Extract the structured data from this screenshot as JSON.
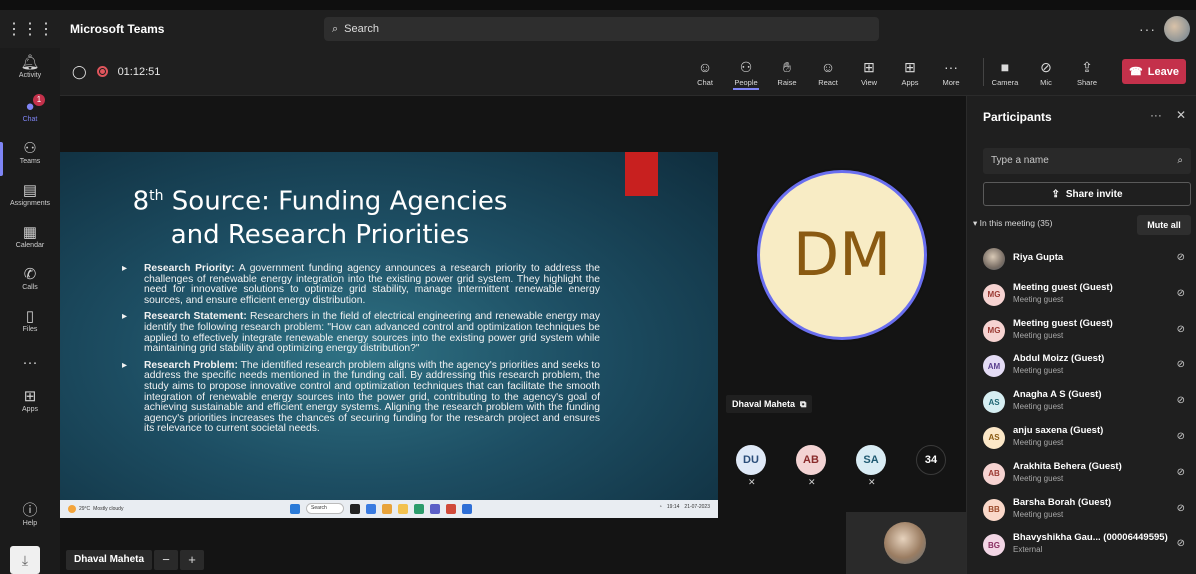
{
  "topbar": {
    "app_title": "Microsoft Teams",
    "search_placeholder": "Search"
  },
  "rail": [
    {
      "label": "Activity",
      "icon": "bell-icon"
    },
    {
      "label": "Chat",
      "icon": "chat-icon",
      "badge": "1",
      "active": true
    },
    {
      "label": "Teams",
      "icon": "teams-icon"
    },
    {
      "label": "Assignments",
      "icon": "assignments-icon"
    },
    {
      "label": "Calendar",
      "icon": "calendar-icon"
    },
    {
      "label": "Calls",
      "icon": "phone-icon"
    },
    {
      "label": "Files",
      "icon": "file-icon"
    },
    {
      "label": "Apps",
      "icon": "apps-icon"
    },
    {
      "label": "Help",
      "icon": "help-icon"
    }
  ],
  "meeting": {
    "timer": "01:12:51",
    "tools": [
      {
        "label": "Chat",
        "icon": "chat-icon"
      },
      {
        "label": "People",
        "icon": "people-icon",
        "selected": true
      },
      {
        "label": "Raise",
        "icon": "raise-hand-icon"
      },
      {
        "label": "React",
        "icon": "react-icon"
      },
      {
        "label": "View",
        "icon": "view-icon"
      },
      {
        "label": "Apps",
        "icon": "apps-icon"
      },
      {
        "label": "More",
        "icon": "more-icon"
      }
    ],
    "devices": [
      {
        "label": "Camera",
        "icon": "camera-off-icon"
      },
      {
        "label": "Mic",
        "icon": "mic-off-icon"
      },
      {
        "label": "Share",
        "icon": "share-icon"
      }
    ],
    "leave_label": "Leave"
  },
  "slide": {
    "title_pre": "8",
    "title_sup": "th",
    "title_rest": " Source: Funding Agencies",
    "title_line2": "and Research Priorities",
    "bullets": [
      {
        "head": "Research Priority:",
        "text": " A government funding agency announces a research priority to address the challenges of renewable energy integration into the existing power grid system. They highlight the need for innovative solutions to optimize grid stability, manage intermittent renewable energy sources, and ensure efficient energy distribution."
      },
      {
        "head": "Research Statement:",
        "text": " Researchers in the field of electrical engineering and renewable energy may identify the following research problem: \"How can advanced control and optimization techniques be applied to effectively integrate renewable energy sources into the existing power grid system while maintaining grid stability and optimizing energy distribution?\""
      },
      {
        "head": "Research Problem:",
        "text": " The identified research problem aligns with the agency's priorities and seeks to address the specific needs mentioned in the funding call. By addressing this research problem, the study aims to propose innovative control and optimization techniques that can facilitate the smooth integration of renewable energy sources into the power grid, contributing to the agency's goal of achieving sustainable and efficient energy systems. Aligning the research problem with the funding agency's priorities increases the chances of securing funding for the research project and ensures its relevance to current societal needs."
      }
    ],
    "taskbar": {
      "weather": "29°C",
      "weather_sub": "Mostly cloudy",
      "search": "Search",
      "time": "19:14",
      "date": "21-07-2023"
    }
  },
  "presenter": {
    "name": "Dhaval Maheta"
  },
  "spotlight": {
    "initials": "DM",
    "name": "Dhaval Maheta"
  },
  "mini_tiles": [
    {
      "initials": "DU",
      "bg": "#dfe9f7",
      "fg": "#2b4e7a"
    },
    {
      "initials": "AB",
      "bg": "#f3d3d3",
      "fg": "#8a2b2b"
    },
    {
      "initials": "SA",
      "bg": "#d9ecf4",
      "fg": "#1f5a72"
    }
  ],
  "more_count": "34",
  "panel": {
    "title": "Participants",
    "search_placeholder": "Type a name",
    "share_invite": "Share invite",
    "section": "In this meeting (35)",
    "mute_all": "Mute all",
    "participants": [
      {
        "initials": "",
        "name": "Riya Gupta",
        "sub": "",
        "bg": "photo",
        "fg": "#000"
      },
      {
        "initials": "MG",
        "name": "Meeting guest (Guest)",
        "sub": "Meeting guest",
        "bg": "#f6d3d1",
        "fg": "#9b3a33"
      },
      {
        "initials": "MG",
        "name": "Meeting guest (Guest)",
        "sub": "Meeting guest",
        "bg": "#f6d3d1",
        "fg": "#9b3a33"
      },
      {
        "initials": "AM",
        "name": "Abdul Moizz (Guest)",
        "sub": "Meeting guest",
        "bg": "#e4dcf5",
        "fg": "#5a3f8f"
      },
      {
        "initials": "AS",
        "name": "Anagha A S (Guest)",
        "sub": "Meeting guest",
        "bg": "#d6eef2",
        "fg": "#1f6572"
      },
      {
        "initials": "AS",
        "name": "anju saxena (Guest)",
        "sub": "Meeting guest",
        "bg": "#fbe7c7",
        "fg": "#8a5a12"
      },
      {
        "initials": "AB",
        "name": "Arakhita Behera (Guest)",
        "sub": "Meeting guest",
        "bg": "#f6d3d1",
        "fg": "#9b3a33"
      },
      {
        "initials": "BB",
        "name": "Barsha Borah (Guest)",
        "sub": "Meeting guest",
        "bg": "#fad8c9",
        "fg": "#9b4a2b"
      },
      {
        "initials": "BG",
        "name": "Bhavyshikha Gau... (00006449595)",
        "sub": "External",
        "bg": "#f2d6e5",
        "fg": "#8a2f62"
      }
    ]
  },
  "colors": {
    "accent": "#7f85f5",
    "leave": "#c4314b",
    "badge": "#c4314b"
  }
}
